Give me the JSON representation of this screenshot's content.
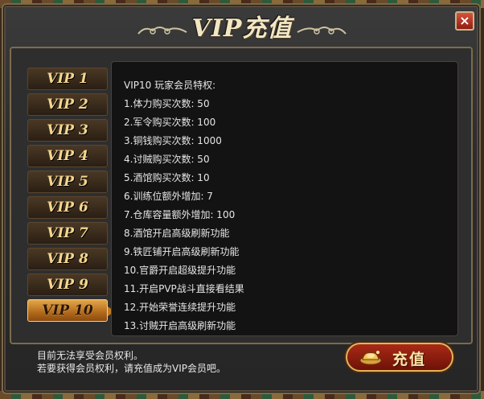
{
  "window": {
    "title": "VIP充值",
    "close_label": "×"
  },
  "tabs": [
    {
      "label": "VIP 1",
      "active": false
    },
    {
      "label": "VIP 2",
      "active": false
    },
    {
      "label": "VIP 3",
      "active": false
    },
    {
      "label": "VIP 4",
      "active": false
    },
    {
      "label": "VIP 5",
      "active": false
    },
    {
      "label": "VIP 6",
      "active": false
    },
    {
      "label": "VIP 7",
      "active": false
    },
    {
      "label": "VIP 8",
      "active": false
    },
    {
      "label": "VIP 9",
      "active": false
    },
    {
      "label": "VIP 10",
      "active": true
    }
  ],
  "privileges": {
    "heading": "VIP10 玩家会员特权:",
    "lines": [
      "1.体力购买次数: 50",
      "2.军令购买次数: 100",
      "3.铜钱购买次数: 1000",
      "4.讨贼购买次数: 50",
      "5.酒馆购买次数: 10",
      "6.训练位额外增加: 7",
      "7.仓库容量额外增加: 100",
      "8.酒馆开启高级刷新功能",
      "9.铁匠铺开启高级刷新功能",
      "10.官爵开启超级提升功能",
      "11.开启PVP战斗直接看结果",
      "12.开始荣誉连续提升功能",
      "13.讨贼开启高级刷新功能"
    ]
  },
  "footer": {
    "status": "目前无法享受会员权利。",
    "hint": "若要获得会员权利，请充值成为VIP会员吧。"
  },
  "recharge_button": {
    "label": "充值",
    "icon": "gold-ingot-icon"
  },
  "colors": {
    "accent_gold": "#e0b55a",
    "active_tab": "#c27c26",
    "button_red": "#a82a16"
  }
}
